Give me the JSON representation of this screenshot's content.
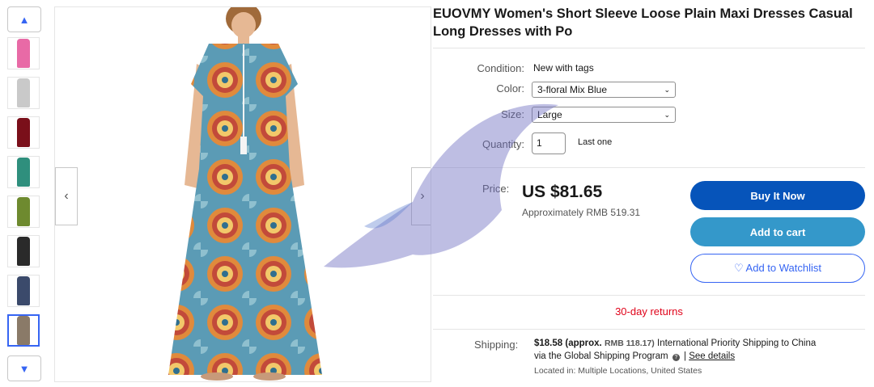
{
  "thumbnails": [
    {
      "color": "#e86aa6"
    },
    {
      "color": "#c9c9c9"
    },
    {
      "color": "#7a0f1a"
    },
    {
      "color": "#2f8f7d"
    },
    {
      "color": "#6e8a2f"
    },
    {
      "color": "#2a2a2a"
    },
    {
      "color": "#3b4a6b"
    },
    {
      "color": "#8a7a68"
    }
  ],
  "icons": {
    "up": "▲",
    "down": "▼",
    "prev": "‹",
    "next": "›",
    "select_chevron": "⌄"
  },
  "listing": {
    "title": "EUOVMY Women's Short Sleeve Loose Plain Maxi Dresses Casual Long Dresses with Po"
  },
  "details": {
    "condition_label": "Condition:",
    "condition_value": "New with tags",
    "color_label": "Color:",
    "color_value": "3-floral Mix Blue",
    "size_label": "Size:",
    "size_value": "Large",
    "quantity_label": "Quantity:",
    "quantity_value": "1",
    "quantity_note": "Last one"
  },
  "pricing": {
    "price_label": "Price:",
    "price": "US $81.65",
    "approx": "Approximately RMB 519.31"
  },
  "actions": {
    "buy_now": "Buy It Now",
    "add_to_cart": "Add to cart",
    "watchlist": "♡ Add to Watchlist"
  },
  "returns": "30-day returns",
  "shipping": {
    "label": "Shipping:",
    "cost": "$18.58 (approx.",
    "cost_rmb": "RMB 118.17)",
    "method": "International Priority Shipping to China",
    "program": "via the Global Shipping Program",
    "see_details": "See details",
    "located": "Located in: Multiple Locations, United States"
  },
  "colors": {
    "buy_now": "#0654ba",
    "add_to_cart": "#3498ca",
    "link": "#3665f3",
    "returns": "#e0031a"
  }
}
